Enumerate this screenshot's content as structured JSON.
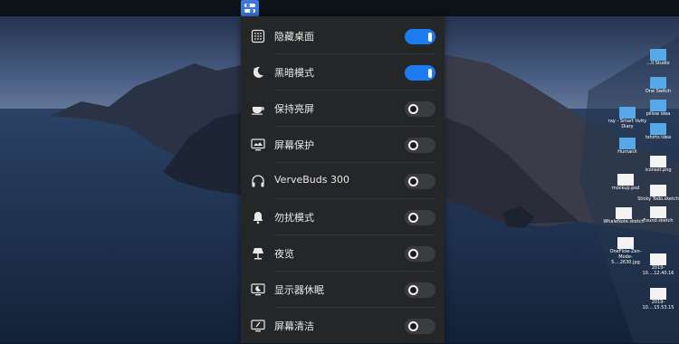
{
  "menubar": {
    "active_icon": "toggles-icon",
    "accent": "#3f79d8"
  },
  "panel": {
    "items": [
      {
        "label": "隐藏桌面",
        "icon": "grid-icon",
        "state": "on"
      },
      {
        "label": "黑暗模式",
        "icon": "moon-icon",
        "state": "on"
      },
      {
        "label": "保持亮屏",
        "icon": "coffee-icon",
        "state": "off"
      },
      {
        "label": "屏幕保护",
        "icon": "monitor-icon",
        "state": "off"
      },
      {
        "label": "VerveBuds 300",
        "icon": "headphones-icon",
        "state": "off"
      },
      {
        "label": "勿扰模式",
        "icon": "bell-icon",
        "state": "off"
      },
      {
        "label": "夜览",
        "icon": "lamp-icon",
        "state": "off"
      },
      {
        "label": "显示器休眠",
        "icon": "display-sleep-icon",
        "state": "off"
      },
      {
        "label": "屏幕清洁",
        "icon": "screen-clean-icon",
        "state": "off"
      }
    ],
    "toggle_on_color": "#1d7bf2"
  },
  "desktop": {
    "items": [
      {
        "name": "...ll Studio",
        "kind": "folder"
      },
      {
        "name": "One Switch",
        "kind": "folder"
      },
      {
        "name": "pillow idea",
        "kind": "folder"
      },
      {
        "name": "ray - Smart tivity Diary",
        "kind": "folder"
      },
      {
        "name": "tshirts idea",
        "kind": "folder"
      },
      {
        "name": "HumanX",
        "kind": "folder"
      },
      {
        "name": "iconset.png",
        "kind": "file"
      },
      {
        "name": "mockup.psd",
        "kind": "file"
      },
      {
        "name": "Sticky Todo.sketch",
        "kind": "file"
      },
      {
        "name": "WhaleNote.sketch",
        "kind": "file"
      },
      {
        "name": "Found.sketch",
        "kind": "file"
      },
      {
        "name": "OneFlow-Zen-Mode-5....2630.jpg",
        "kind": "file"
      },
      {
        "name": "2019-10....12.40.16",
        "kind": "file"
      },
      {
        "name": "2019-10....15.53.15",
        "kind": "file"
      }
    ]
  }
}
